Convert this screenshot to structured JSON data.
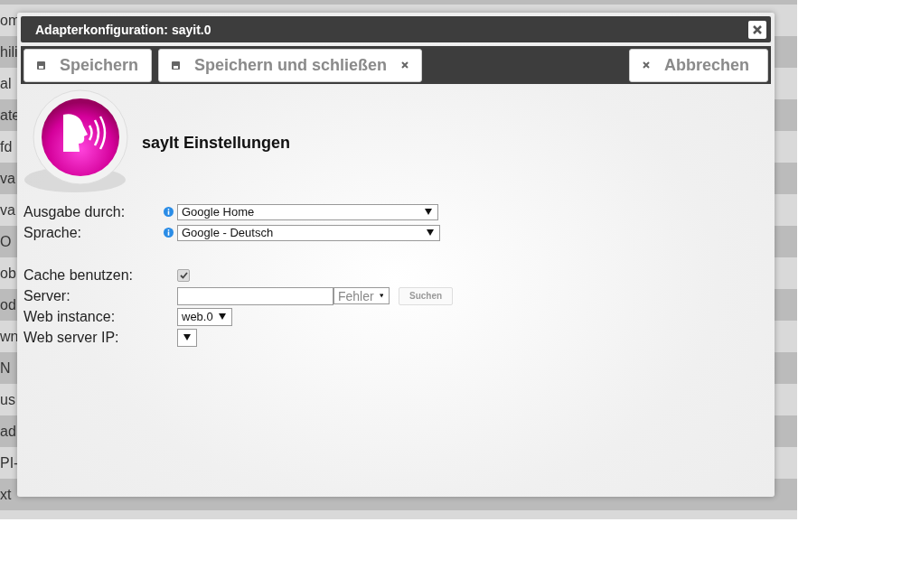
{
  "background_list": {
    "items": [
      "om",
      "hili",
      "al",
      "ate",
      "fd",
      "va",
      "va",
      "O",
      "ob",
      "od",
      "wn",
      "N",
      "us",
      "ad",
      "PI-",
      "xt"
    ]
  },
  "dialog": {
    "title": "Adapterkonfiguration: sayit.0",
    "toolbar": [
      {
        "kind": "save",
        "label": "Speichern"
      },
      {
        "kind": "save-close",
        "label": "Speichern und schließen"
      },
      {
        "kind": "cancel",
        "label": "Abbrechen"
      }
    ],
    "heading": "sayIt Einstellungen",
    "groups": [
      [
        {
          "kind": "select",
          "label": "Ausgabe durch:",
          "info": true,
          "value": "Google Home"
        },
        {
          "kind": "select",
          "label": "Sprache:",
          "info": true,
          "value": "Google - Deutsch"
        }
      ],
      [
        {
          "kind": "checkbox",
          "label": "Cache benutzen:",
          "info": false,
          "checked": true
        },
        {
          "kind": "server",
          "label": "Server:",
          "info": false,
          "status": "Fehler",
          "button": "Suchen"
        },
        {
          "kind": "select",
          "label": "Web instance:",
          "info": false,
          "value": "web.0"
        },
        {
          "kind": "select",
          "label": "Web server IP:",
          "info": false
        }
      ]
    ]
  }
}
